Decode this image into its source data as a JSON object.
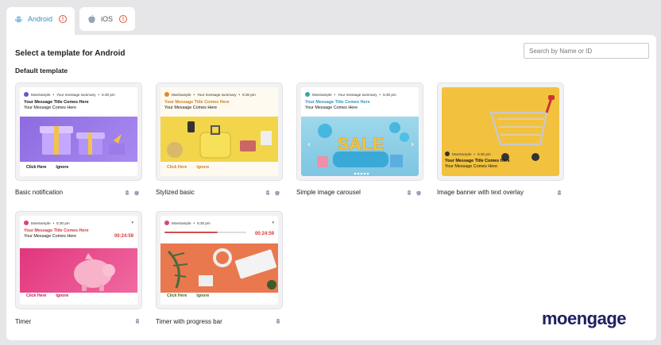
{
  "tabs": [
    {
      "label": "Android",
      "icon": "android-icon",
      "active": true
    },
    {
      "label": "iOS",
      "icon": "apple-icon",
      "active": false
    }
  ],
  "page_title": "Select a template for Android",
  "section_title": "Default template",
  "search": {
    "placeholder": "Search by Name or ID"
  },
  "templates": [
    {
      "name": "Basic notification",
      "app": "MoeSample",
      "summary": "Your message summary",
      "time": "5:30 pm",
      "title": "Your Message Title Comes Here",
      "message": "Your Message Comes Here",
      "action1": "Click Here",
      "action2": "Ignore",
      "platforms": [
        "android",
        "ios"
      ]
    },
    {
      "name": "Stylized basic",
      "app": "MoeSample",
      "summary": "Your message summary",
      "time": "5:30 pm",
      "title": "Your Message Title Comes Here",
      "message": "Your Message Comes Here",
      "action1": "Click Here",
      "action2": "Ignore",
      "platforms": [
        "android",
        "ios"
      ]
    },
    {
      "name": "Simple image carousel",
      "app": "MoeSample",
      "summary": "Your message summary",
      "time": "5:30 pm",
      "title": "Your Message Title Comes Here",
      "message": "Your Message Comes Here",
      "image_text": "SALE",
      "platforms": [
        "android",
        "ios"
      ]
    },
    {
      "name": "Image banner with text overlay",
      "app": "MoeSample",
      "time": "5:30 pm",
      "title": "Your Message Title Comes Here",
      "message": "Your Message Comes Here",
      "platforms": [
        "android"
      ]
    },
    {
      "name": "Timer",
      "app": "MoeSample",
      "time": "5:30 pm",
      "title": "Your Message Title Comes Here",
      "message": "Your Message Comes Here",
      "timer": "00:24:59",
      "action1": "Click Here",
      "action2": "Ignore",
      "platforms": [
        "android"
      ]
    },
    {
      "name": "Timer with progress bar",
      "app": "MoeSample",
      "time": "5:30 pm",
      "timer": "00:24:59",
      "progress": 0.65,
      "action1": "Click Here",
      "action2": "Ignore",
      "platforms": [
        "android"
      ]
    }
  ],
  "brand": "moengage",
  "colors": {
    "accent": "#3b8fbd",
    "warning": "#d9583b",
    "brand": "#1f2060"
  }
}
